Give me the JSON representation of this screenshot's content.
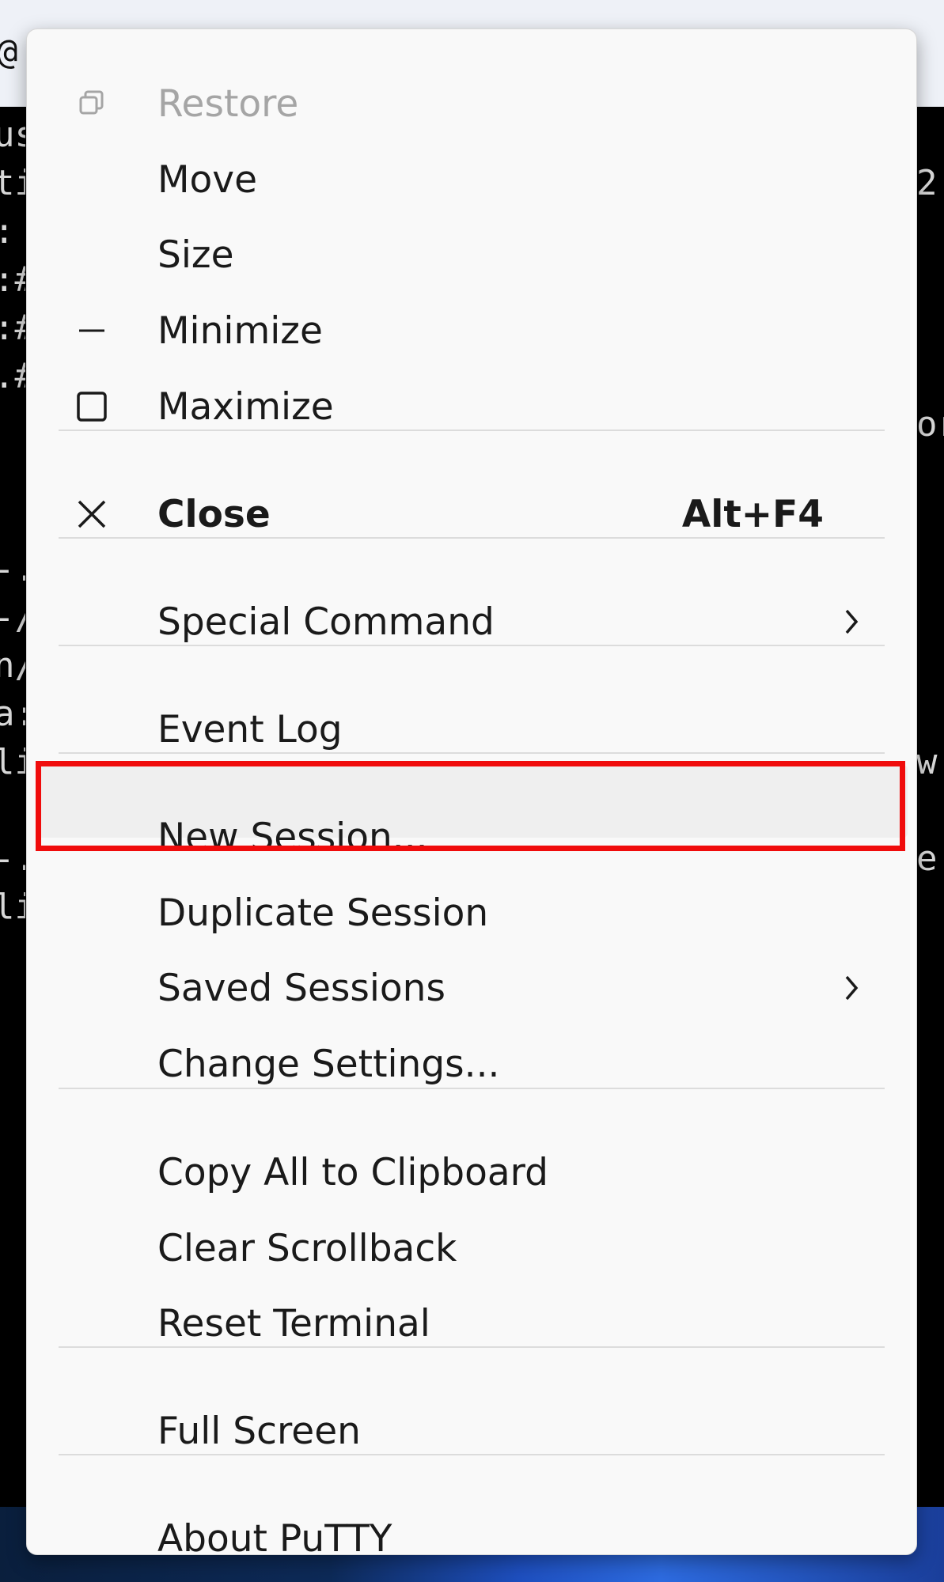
{
  "background": {
    "title_fragment": "@",
    "terminal_left_chars": "us\nti\n:\n:#\n:#\n.#\n\n\n\n-.\n-/\nn/\na:\nli\n\n-.\nli",
    "terminal_right_chars": "\n2\n\n\n\n\nor\n\n\n\n\n\n\nw\n\ne"
  },
  "menu": {
    "items": [
      {
        "label": "Restore",
        "icon": "restore-icon",
        "disabled": true
      },
      {
        "label": "Move"
      },
      {
        "label": "Size"
      },
      {
        "label": "Minimize",
        "icon": "minimize-icon"
      },
      {
        "label": "Maximize",
        "icon": "maximize-icon"
      },
      {
        "label": "Close",
        "icon": "close-icon",
        "shortcut": "Alt+F4",
        "bold": true
      },
      {
        "label": "Special Command",
        "submenu": true
      },
      {
        "label": "Event Log"
      },
      {
        "label": "New Session...",
        "highlighted": true
      },
      {
        "label": "Duplicate Session"
      },
      {
        "label": "Saved Sessions",
        "submenu": true
      },
      {
        "label": "Change Settings..."
      },
      {
        "label": "Copy All to Clipboard"
      },
      {
        "label": "Clear Scrollback"
      },
      {
        "label": "Reset Terminal"
      },
      {
        "label": "Full Screen"
      },
      {
        "label": "About PuTTY"
      }
    ]
  },
  "colors": {
    "menu_bg": "#f9f9f9",
    "highlight_outline": "#f00c0c",
    "disabled_text": "#a5a5a5"
  }
}
